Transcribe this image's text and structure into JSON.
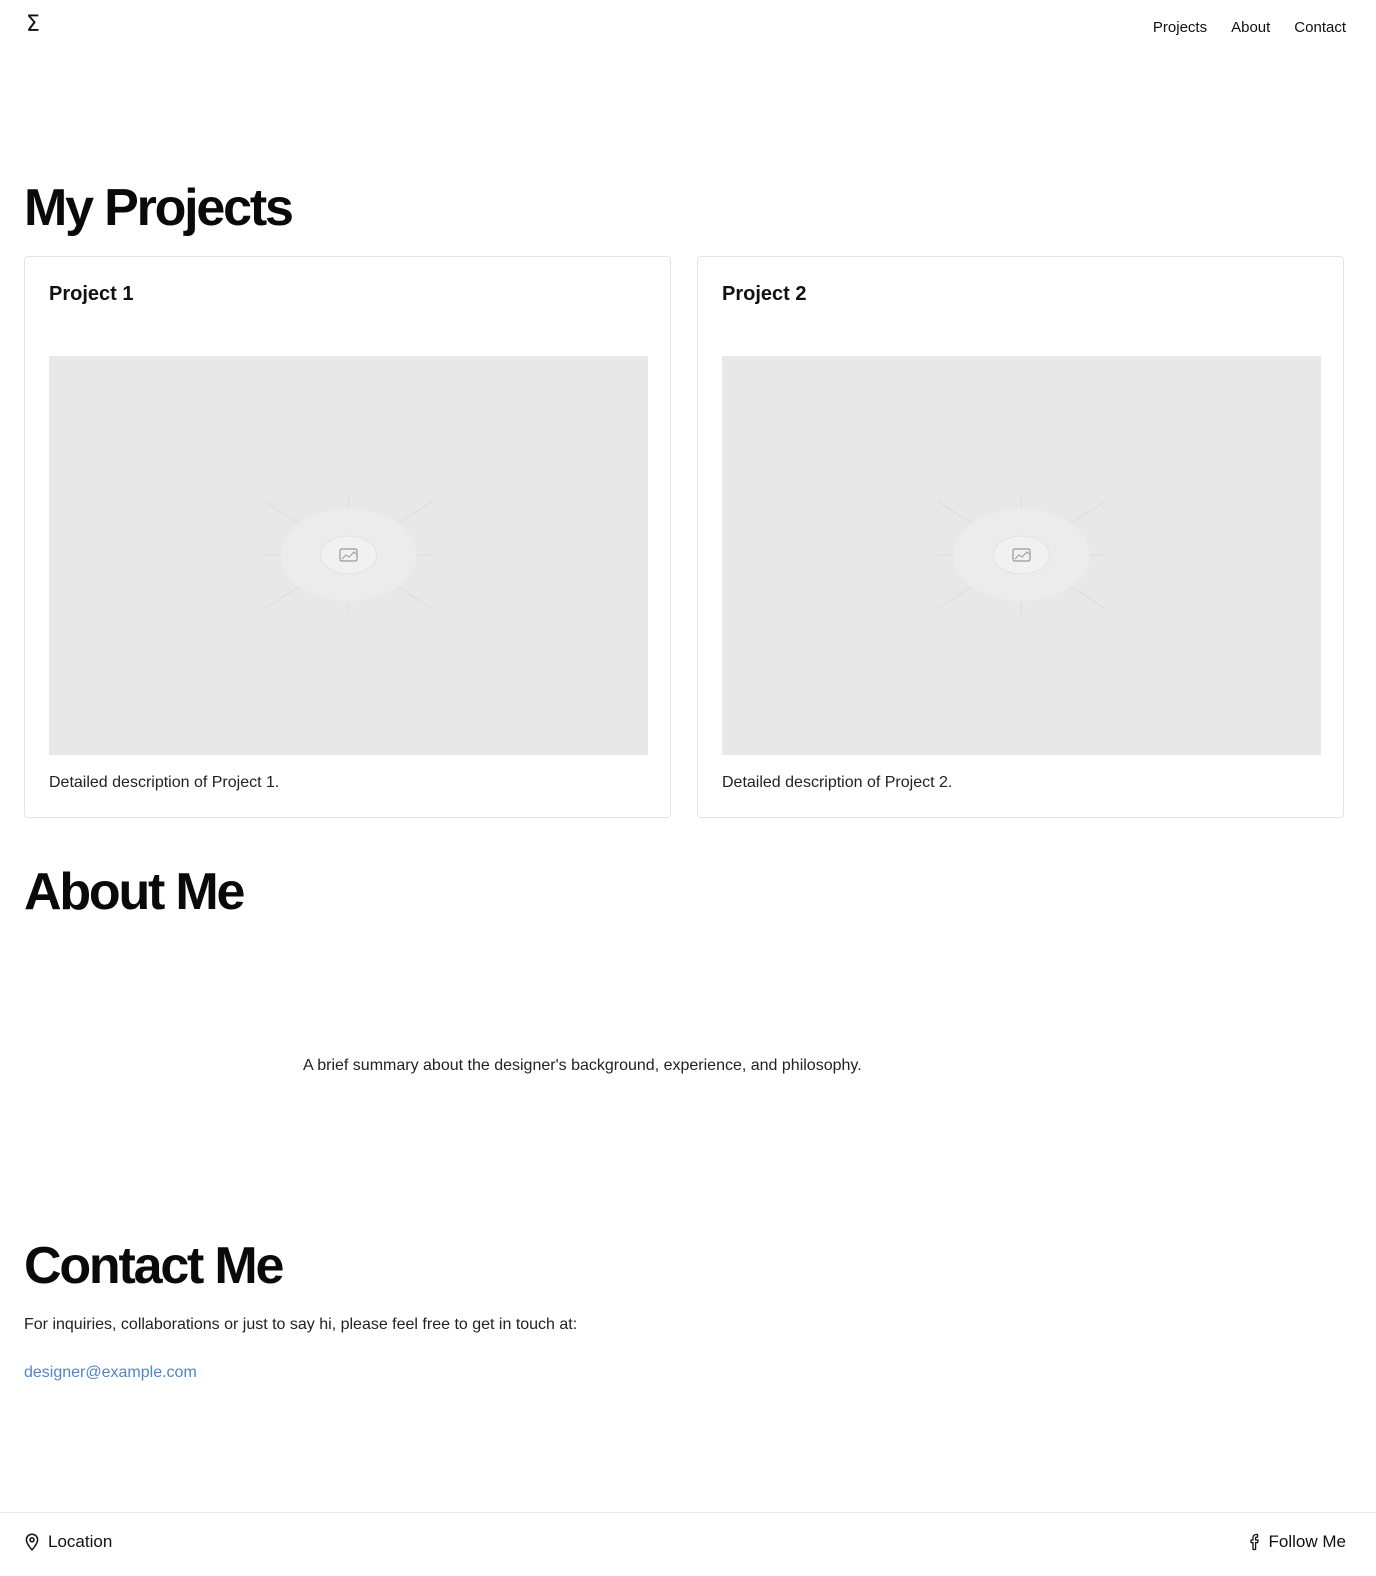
{
  "header": {
    "logo": "Σ",
    "nav": [
      "Projects",
      "About",
      "Contact"
    ]
  },
  "projects": {
    "heading": "My Projects",
    "items": [
      {
        "title": "Project 1",
        "description": "Detailed description of Project 1.",
        "image_icon": "image-placeholder-icon"
      },
      {
        "title": "Project 2",
        "description": "Detailed description of Project 2.",
        "image_icon": "image-placeholder-icon"
      }
    ]
  },
  "about": {
    "heading": "About Me",
    "text": "A brief summary about the designer's background, experience, and philosophy."
  },
  "contact": {
    "heading": "Contact Me",
    "text": "For inquiries, collaborations or just to say hi, please feel free to get in touch at:",
    "email": "designer@example.com"
  },
  "footer": {
    "location_icon": "map-pin-icon",
    "location_label": "Location",
    "social_icon": "facebook-icon",
    "social_label": "Follow Me"
  },
  "colors": {
    "link": "#4f86c6",
    "placeholder_bg": "#e8e8e8"
  }
}
